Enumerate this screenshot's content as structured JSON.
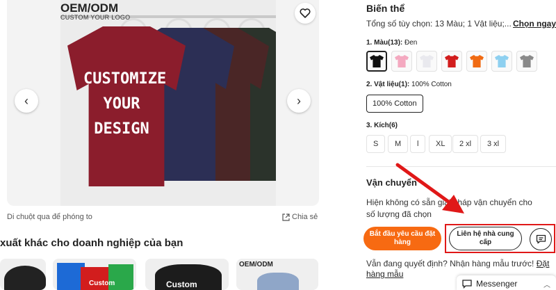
{
  "gallery": {
    "brand_title": "OEM/ODM",
    "brand_sub": "CUSTOM YOUR LOGO",
    "promo_line1": "CUSTOMIZE",
    "promo_line2": "YOUR",
    "promo_line3": "DESIGN",
    "prev_glyph": "‹",
    "next_glyph": "›",
    "hint": "Di chuột qua để phóng to",
    "share_label": "Chia sẻ",
    "shirt_colors": [
      "#8b1d2c",
      "#2c2f55",
      "#4a2626",
      "#2b332b"
    ]
  },
  "related": {
    "title": "xuất khác cho doanh nghiệp của bạn",
    "thumb_labels": [
      "Custom",
      "Custom",
      "OEM/ODM"
    ]
  },
  "panel": {
    "heading": "Biến thể",
    "summary": "Tổng số tùy chọn: 13 Màu; 1 Vật liệu;...",
    "choose_link": "Chọn ngay",
    "color_label_key": "1. Màu(13):",
    "color_label_val": "Đen",
    "swatches": [
      {
        "color": "#111111",
        "selected": true
      },
      {
        "color": "#f4a9c0",
        "selected": false
      },
      {
        "color": "#e9e9ee",
        "selected": false
      },
      {
        "color": "#d21d1d",
        "selected": false
      },
      {
        "color": "#f06a12",
        "selected": false
      },
      {
        "color": "#8ed0f0",
        "selected": false
      },
      {
        "color": "#8a8a8a",
        "selected": false
      }
    ],
    "material_label_key": "2. Vật liệu(1):",
    "material_label_val": "100% Cotton",
    "material_option": "100% Cotton",
    "size_label_key": "3. Kích(6)",
    "sizes": [
      "S",
      "M",
      "l",
      "XL",
      "2 xl",
      "3 xl"
    ],
    "shipping_heading": "Vận chuyển",
    "shipping_note": "Hiện không có sẵn giải pháp vận chuyển cho số lượng đã chọn",
    "primary_btn": "Bắt đầu yêu cầu đặt hàng",
    "contact_btn": "Liên hệ nhà cung cấp",
    "sample_text": "Vẫn đang quyết định? Nhận hàng mẫu trước! ",
    "sample_link": "Đặt hàng mẫu",
    "messenger_label": "Messenger"
  },
  "colors": {
    "accent": "#f76a12",
    "highlight": "#e01818"
  }
}
